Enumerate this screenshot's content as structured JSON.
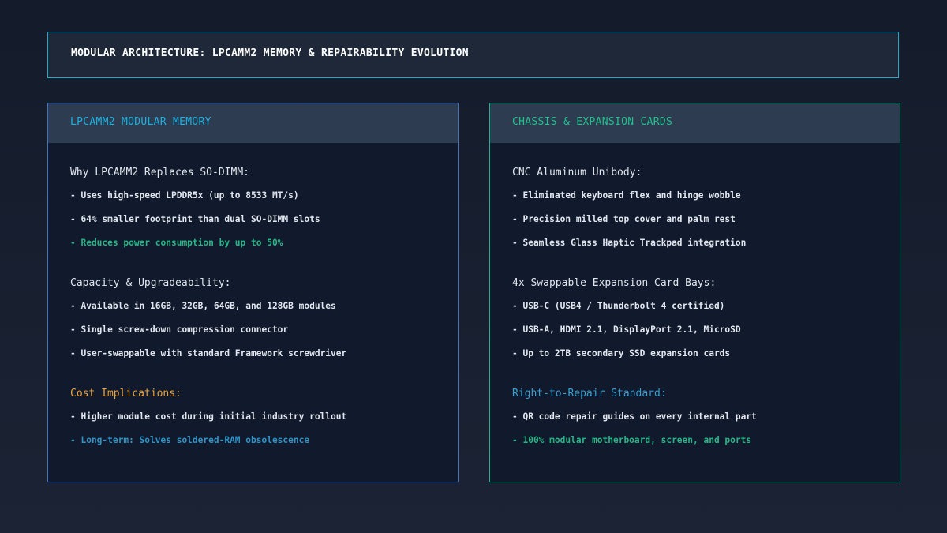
{
  "header": {
    "title": "MODULAR ARCHITECTURE: LPCAMM2 MEMORY & REPAIRABILITY EVOLUTION"
  },
  "left_panel": {
    "title": "LPCAMM2 MODULAR MEMORY",
    "sections": [
      {
        "heading": "Why LPCAMM2 Replaces SO-DIMM:",
        "items": [
          "- Uses high-speed LPDDR5x (up to 8533 MT/s)",
          "- 64% smaller footprint than dual SO-DIMM slots",
          "- Reduces power consumption by up to 50%"
        ]
      },
      {
        "heading": "Capacity & Upgradeability:",
        "items": [
          "- Available in 16GB, 32GB, 64GB, and 128GB modules",
          "- Single screw-down compression connector",
          "- User-swappable with standard Framework screwdriver"
        ]
      },
      {
        "heading": "Cost Implications:",
        "items": [
          "- Higher module cost during initial industry rollout",
          "- Long-term: Solves soldered-RAM obsolescence"
        ]
      }
    ]
  },
  "right_panel": {
    "title": "CHASSIS & EXPANSION CARDS",
    "sections": [
      {
        "heading": "CNC Aluminum Unibody:",
        "items": [
          "- Eliminated keyboard flex and hinge wobble",
          "- Precision milled top cover and palm rest",
          "- Seamless Glass Haptic Trackpad integration"
        ]
      },
      {
        "heading": "4x Swappable Expansion Card Bays:",
        "items": [
          "- USB-C (USB4 / Thunderbolt 4 certified)",
          "- USB-A, HDMI 2.1, DisplayPort 2.1, MicroSD",
          "- Up to 2TB secondary SSD expansion cards"
        ]
      },
      {
        "heading": "Right-to-Repair Standard:",
        "items": [
          "- QR code repair guides on every internal part",
          "- 100% modular motherboard, screen, and ports"
        ]
      }
    ]
  }
}
